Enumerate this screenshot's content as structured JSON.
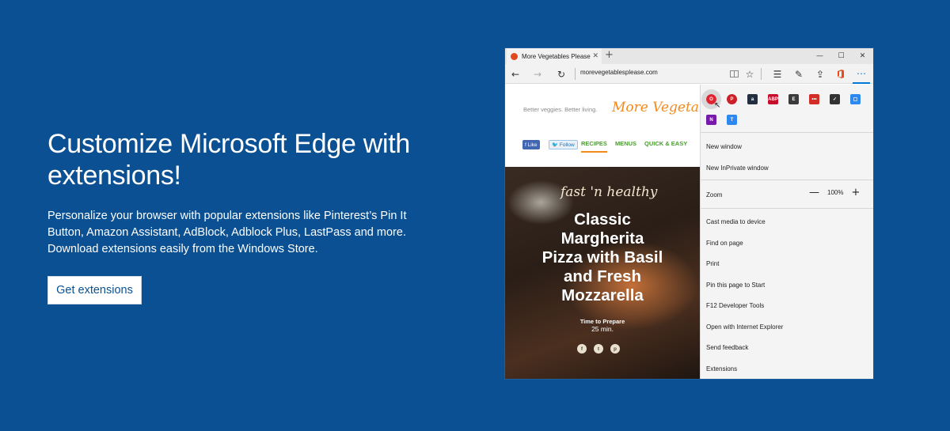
{
  "hero": {
    "title": "Customize Microsoft Edge with extensions!",
    "description": "Personalize your browser with popular extensions like Pinterest’s Pin It Button, Amazon Assistant, AdBlock, Adblock Plus, LastPass and more. Download extensions easily from the Windows Store.",
    "cta_label": "Get extensions"
  },
  "browser": {
    "tab_title": "More Vegetables Please",
    "tab_close": "✕",
    "new_tab": "+",
    "address": "morevegetablesplease.com",
    "controls": {
      "back": "←",
      "forward": "→",
      "refresh": "↻",
      "minimize": "—",
      "maximize": "☐",
      "close": "✕"
    },
    "toolbar_icons": [
      "reading-view-icon",
      "favorite-star-icon",
      "hub-icon",
      "web-note-icon",
      "share-icon",
      "office-icon",
      "more-icon"
    ]
  },
  "site": {
    "tagline": "Better veggies. Better living.",
    "logo": "More Vegetables",
    "fb_like": "f Like",
    "tw_follow": "🐦 Follow",
    "nav": [
      "RECIPES",
      "MENUS",
      "QUICK & EASY"
    ],
    "hero_script": "fast 'n healthy",
    "headline": "Classic\nMargherita\nPizza with Basil\nand Fresh\nMozzarella",
    "prep_label": "Time to Prepare",
    "prep_time": "25 min.",
    "share": [
      "f",
      "t",
      "p"
    ]
  },
  "menu": {
    "extensions": [
      {
        "name": "opera-icon",
        "glyph": "O",
        "color": "#e0232e"
      },
      {
        "name": "pinterest-icon",
        "glyph": "P",
        "color": "#cb2027"
      },
      {
        "name": "amazon-icon",
        "glyph": "a",
        "color": "#232f3e"
      },
      {
        "name": "adblock-plus-icon",
        "glyph": "ABP",
        "color": "#c70d2c"
      },
      {
        "name": "evernote-icon",
        "glyph": "E",
        "color": "#3b3b3b"
      },
      {
        "name": "lastpass-icon",
        "glyph": "•••",
        "color": "#d32d27"
      },
      {
        "name": "pocket-icon",
        "glyph": "✓",
        "color": "#333333"
      },
      {
        "name": "feedback-hub-icon",
        "glyph": "▢",
        "color": "#2d89ef"
      },
      {
        "name": "onenote-icon",
        "glyph": "N",
        "color": "#7719aa"
      },
      {
        "name": "microsoft-translator-icon",
        "glyph": "T",
        "color": "#2d89ef"
      }
    ],
    "items": {
      "new_window": "New window",
      "inprivate": "New InPrivate window",
      "zoom": "Zoom",
      "zoom_level": "100%",
      "zoom_out": "—",
      "zoom_in": "+",
      "cast": "Cast media to device",
      "find": "Find on page",
      "print": "Print",
      "pin": "Pin this page to Start",
      "devtools": "F12 Developer Tools",
      "ie": "Open with Internet Explorer",
      "feedback": "Send feedback",
      "extensions": "Extensions"
    }
  }
}
